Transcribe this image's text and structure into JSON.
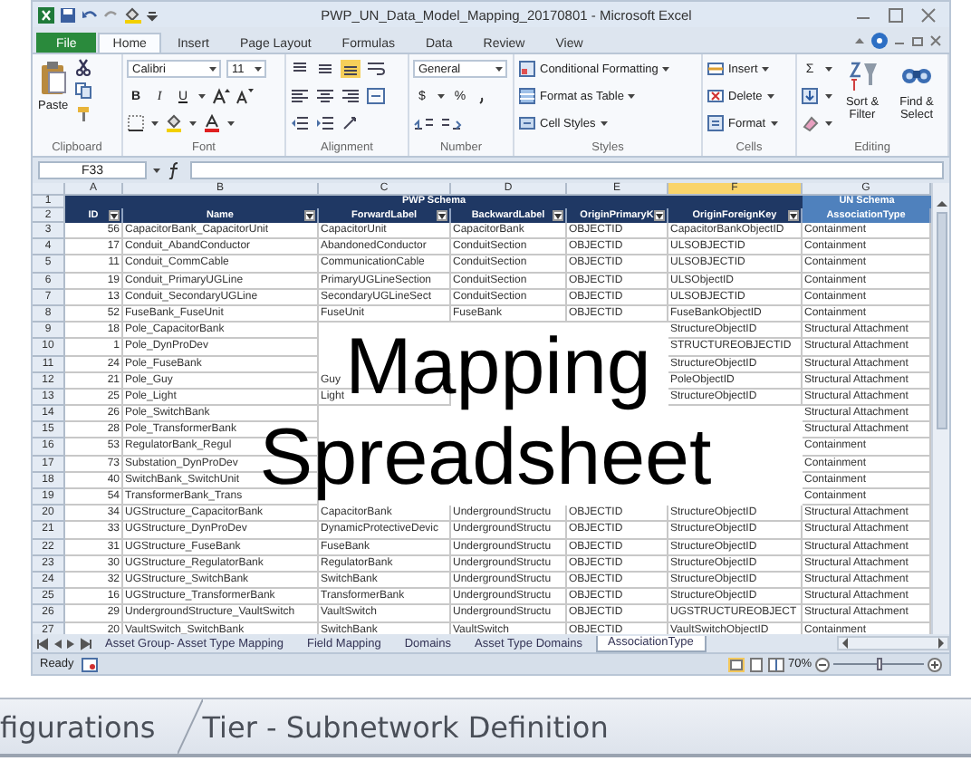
{
  "window": {
    "title": "PWP_UN_Data_Model_Mapping_20170801 - Microsoft Excel"
  },
  "ribbon_tabs": [
    {
      "label": "File",
      "kind": "file",
      "selected": false
    },
    {
      "label": "Home",
      "kind": "tab",
      "selected": true
    },
    {
      "label": "Insert",
      "kind": "tab",
      "selected": false
    },
    {
      "label": "Page Layout",
      "kind": "tab",
      "selected": false
    },
    {
      "label": "Formulas",
      "kind": "tab",
      "selected": false
    },
    {
      "label": "Data",
      "kind": "tab",
      "selected": false
    },
    {
      "label": "Review",
      "kind": "tab",
      "selected": false
    },
    {
      "label": "View",
      "kind": "tab",
      "selected": false
    }
  ],
  "ribbon": {
    "groups": [
      {
        "kind": "clipboard",
        "label": "Clipboard",
        "paste": "Paste"
      },
      {
        "kind": "font",
        "label": "Font",
        "font_name": "Calibri",
        "font_size": "11",
        "bold": "B",
        "italic": "I",
        "underline": "U"
      },
      {
        "kind": "alignment",
        "label": "Alignment"
      },
      {
        "kind": "number",
        "label": "Number",
        "format": "General",
        "currency": "$",
        "percent": "%"
      },
      {
        "kind": "styles",
        "label": "Styles",
        "buttons": [
          "Conditional Formatting",
          "Format as Table",
          "Cell Styles"
        ]
      },
      {
        "kind": "cells",
        "label": "Cells",
        "buttons": [
          "Insert",
          "Delete",
          "Format"
        ]
      },
      {
        "kind": "editing",
        "label": "Editing",
        "sum": "Σ",
        "buttons": [
          "Sort & Filter",
          "Find & Select"
        ]
      }
    ]
  },
  "formula_bar": {
    "name_box": "F33"
  },
  "sheet": {
    "columns": [
      {
        "letter": "A",
        "selected": false
      },
      {
        "letter": "B",
        "selected": false
      },
      {
        "letter": "C",
        "selected": false
      },
      {
        "letter": "D",
        "selected": false
      },
      {
        "letter": "E",
        "selected": false
      },
      {
        "letter": "F",
        "selected": true
      },
      {
        "letter": "G",
        "selected": false
      }
    ],
    "group_header": {
      "num": "1",
      "left": "PWP Schema",
      "right": "UN Schema"
    },
    "header": {
      "num": "2",
      "cells": [
        {
          "text": "ID",
          "filter": true
        },
        {
          "text": "Name",
          "filter": true
        },
        {
          "text": "ForwardLabel",
          "filter": true
        },
        {
          "text": "BackwardLabel",
          "filter": true
        },
        {
          "text": "OriginPrimaryK",
          "filter": true
        },
        {
          "text": "OriginForeignKey",
          "filter": true
        },
        {
          "text": "AssociationType",
          "filter": false
        }
      ]
    },
    "rows": [
      {
        "num": "3",
        "cells": [
          "56",
          "CapacitorBank_CapacitorUnit",
          "CapacitorUnit",
          "CapacitorBank",
          "OBJECTID",
          "CapacitorBankObjectID",
          "Containment"
        ]
      },
      {
        "num": "4",
        "cells": [
          "17",
          "Conduit_AbandConductor",
          "AbandonedConductor",
          "ConduitSection",
          "OBJECTID",
          "ULSOBJECTID",
          "Containment"
        ]
      },
      {
        "num": "5",
        "cells": [
          "11",
          "Conduit_CommCable",
          "CommunicationCable",
          "ConduitSection",
          "OBJECTID",
          "ULSOBJECTID",
          "Containment"
        ]
      },
      {
        "num": "6",
        "cells": [
          "19",
          "Conduit_PrimaryUGLine",
          "PrimaryUGLineSection",
          "ConduitSection",
          "OBJECTID",
          "ULSObjectID",
          "Containment"
        ]
      },
      {
        "num": "7",
        "cells": [
          "13",
          "Conduit_SecondaryUGLine",
          "SecondaryUGLineSect",
          "ConduitSection",
          "OBJECTID",
          "ULSOBJECTID",
          "Containment"
        ]
      },
      {
        "num": "8",
        "cells": [
          "52",
          "FuseBank_FuseUnit",
          "FuseUnit",
          "FuseBank",
          "OBJECTID",
          "FuseBankObjectID",
          "Containment"
        ]
      },
      {
        "num": "9",
        "cells": [
          "18",
          "Pole_CapacitorBank",
          null,
          null,
          null,
          "StructureObjectID",
          "Structural Attachment"
        ]
      },
      {
        "num": "10",
        "cells": [
          "1",
          "Pole_DynProDev",
          null,
          null,
          null,
          "STRUCTUREOBJECTID",
          "Structural Attachment"
        ]
      },
      {
        "num": "11",
        "cells": [
          "24",
          "Pole_FuseBank",
          null,
          null,
          null,
          "StructureObjectID",
          "Structural Attachment"
        ]
      },
      {
        "num": "12",
        "cells": [
          "21",
          "Pole_Guy",
          "Guy",
          null,
          null,
          "PoleObjectID",
          "Structural Attachment"
        ]
      },
      {
        "num": "13",
        "cells": [
          "25",
          "Pole_Light",
          "Light",
          null,
          null,
          "StructureObjectID",
          "Structural Attachment"
        ]
      },
      {
        "num": "14",
        "cells": [
          "26",
          "Pole_SwitchBank",
          null,
          null,
          null,
          null,
          "Structural Attachment"
        ]
      },
      {
        "num": "15",
        "cells": [
          "28",
          "Pole_TransformerBank",
          null,
          null,
          null,
          null,
          "Structural Attachment"
        ]
      },
      {
        "num": "16",
        "cells": [
          "53",
          "RegulatorBank_Regul",
          null,
          null,
          null,
          null,
          "Containment"
        ]
      },
      {
        "num": "17",
        "cells": [
          "73",
          "Substation_DynProDev",
          null,
          null,
          null,
          null,
          "Containment"
        ]
      },
      {
        "num": "18",
        "cells": [
          "40",
          "SwitchBank_SwitchUnit",
          null,
          null,
          null,
          null,
          "Containment"
        ]
      },
      {
        "num": "19",
        "cells": [
          "54",
          "TransformerBank_Trans",
          null,
          null,
          null,
          null,
          "Containment"
        ]
      },
      {
        "num": "20",
        "cells": [
          "34",
          "UGStructure_CapacitorBank",
          "CapacitorBank",
          "UndergroundStructu",
          "OBJECTID",
          "StructureObjectID",
          "Structural Attachment"
        ]
      },
      {
        "num": "21",
        "cells": [
          "33",
          "UGStructure_DynProDev",
          "DynamicProtectiveDevic",
          "UndergroundStructu",
          "OBJECTID",
          "StructureObjectID",
          "Structural Attachment"
        ]
      },
      {
        "num": "22",
        "cells": [
          "31",
          "UGStructure_FuseBank",
          "FuseBank",
          "UndergroundStructu",
          "OBJECTID",
          "StructureObjectID",
          "Structural Attachment"
        ]
      },
      {
        "num": "23",
        "cells": [
          "30",
          "UGStructure_RegulatorBank",
          "RegulatorBank",
          "UndergroundStructu",
          "OBJECTID",
          "StructureObjectID",
          "Structural Attachment"
        ]
      },
      {
        "num": "24",
        "cells": [
          "32",
          "UGStructure_SwitchBank",
          "SwitchBank",
          "UndergroundStructu",
          "OBJECTID",
          "StructureObjectID",
          "Structural Attachment"
        ]
      },
      {
        "num": "25",
        "cells": [
          "16",
          "UGStructure_TransformerBank",
          "TransformerBank",
          "UndergroundStructu",
          "OBJECTID",
          "StructureObjectID",
          "Structural Attachment"
        ]
      },
      {
        "num": "26",
        "cells": [
          "29",
          "UndergroundStructure_VaultSwitch",
          "VaultSwitch",
          "UndergroundStructu",
          "OBJECTID",
          "UGSTRUCTUREOBJECT",
          "Structural Attachment"
        ]
      },
      {
        "num": "27",
        "cells": [
          "20",
          "VaultSwitch_SwitchBank",
          "SwitchBank",
          "VaultSwitch",
          "OBJECTID",
          "VaultSwitchObjectID",
          "Containment"
        ]
      }
    ]
  },
  "sheet_tabs": [
    {
      "label": "Asset Group- Asset Type Mapping",
      "selected": false
    },
    {
      "label": "Field Mapping",
      "selected": false
    },
    {
      "label": "Domains",
      "selected": false
    },
    {
      "label": "Asset Type Domains",
      "selected": false
    },
    {
      "label": "AssociationType",
      "selected": true
    }
  ],
  "status_bar": {
    "status": "Ready",
    "zoom": "70%",
    "zoom_slider": {
      "level": 0.5
    }
  },
  "overlay_title": [
    "Mapping",
    "Spreadsheet"
  ],
  "bottom_tabs": [
    {
      "label": "figurations"
    },
    {
      "label": "Tier - Subnetwork Definition"
    }
  ]
}
